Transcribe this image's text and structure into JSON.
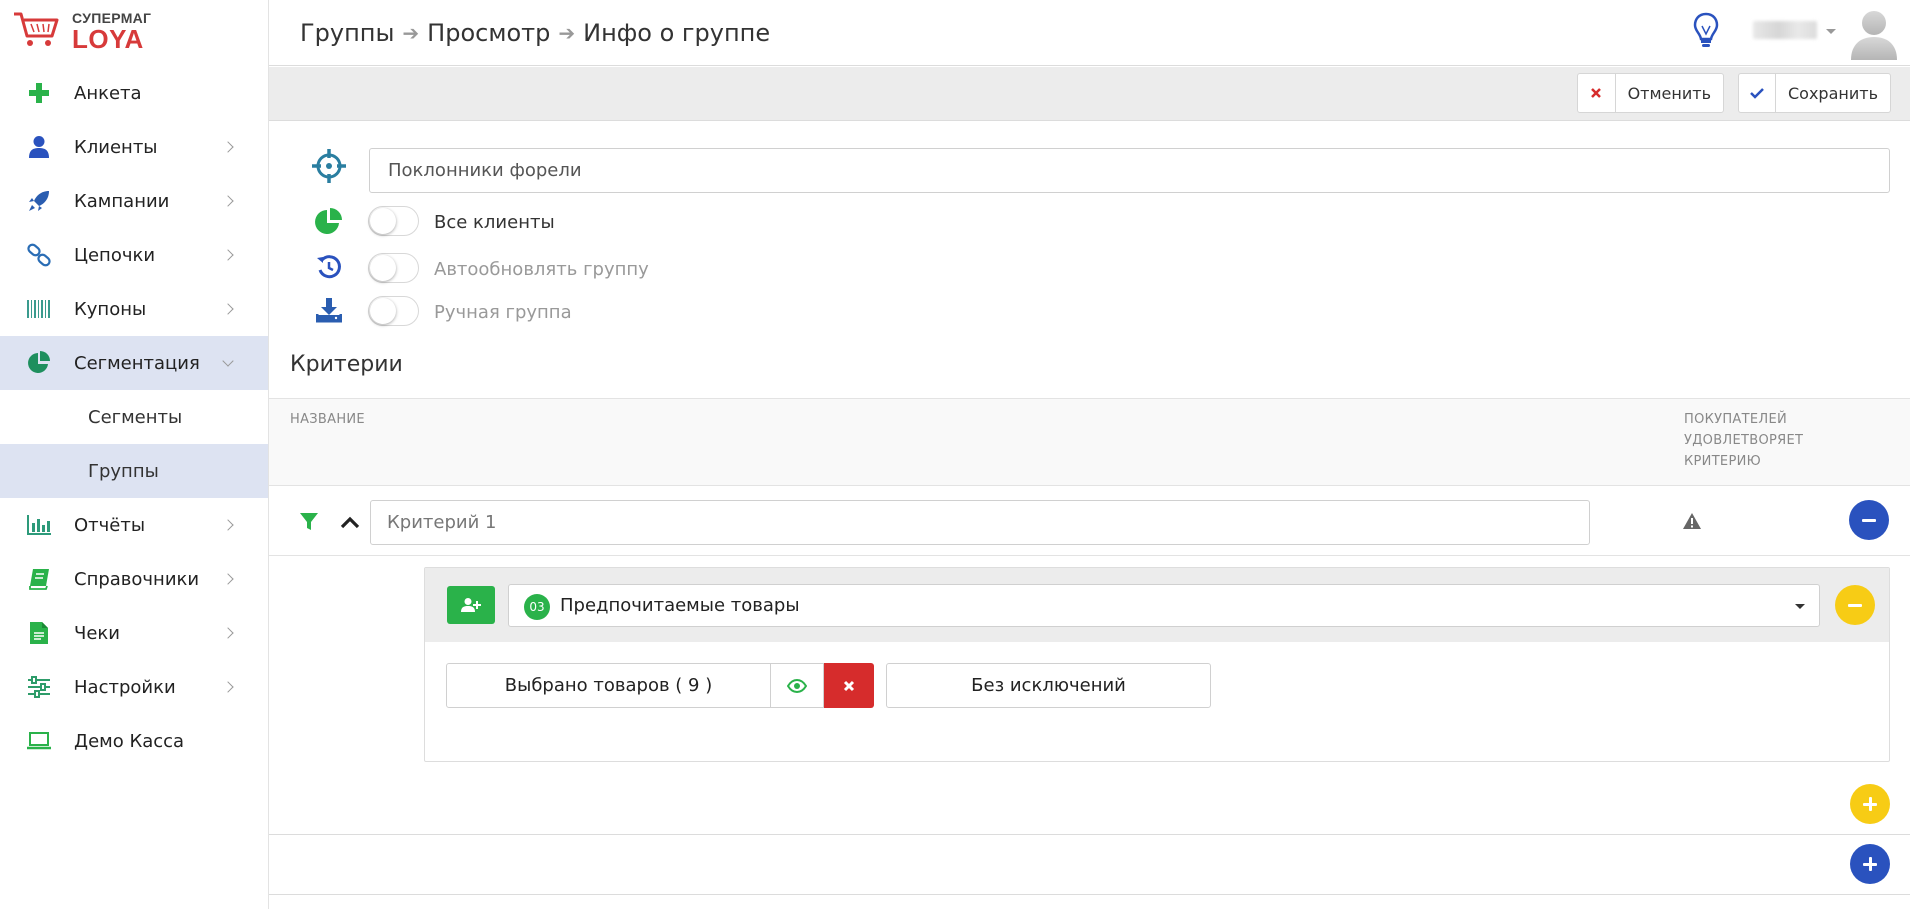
{
  "app": {
    "brand_top": "СУПЕРМАГ",
    "brand_bottom": "LOYA"
  },
  "sidebar": {
    "items": [
      {
        "label": "Анкета",
        "icon": "plus-icon"
      },
      {
        "label": "Клиенты",
        "icon": "user-icon"
      },
      {
        "label": "Кампании",
        "icon": "rocket-icon"
      },
      {
        "label": "Цепочки",
        "icon": "link-icon"
      },
      {
        "label": "Купоны",
        "icon": "barcode-icon"
      },
      {
        "label": "Сегментация",
        "icon": "pie-chart-icon"
      },
      {
        "label": "Отчёты",
        "icon": "bar-chart-icon"
      },
      {
        "label": "Справочники",
        "icon": "book-icon"
      },
      {
        "label": "Чеки",
        "icon": "document-icon"
      },
      {
        "label": "Настройки",
        "icon": "sliders-icon"
      },
      {
        "label": "Демо Касса",
        "icon": "laptop-icon"
      }
    ],
    "subitems": [
      {
        "label": "Сегменты"
      },
      {
        "label": "Группы"
      }
    ]
  },
  "header": {
    "breadcrumb": [
      "Группы",
      "Просмотр",
      "Инфо о группе"
    ]
  },
  "toolbar": {
    "cancel_label": "Отменить",
    "save_label": "Сохранить"
  },
  "form": {
    "group_name": "Поклонники форели",
    "toggles": [
      {
        "label": "Все клиенты",
        "on": false
      },
      {
        "label": "Автообновлять группу",
        "on": false
      },
      {
        "label": "Ручная группа",
        "on": false
      }
    ]
  },
  "criteria": {
    "title": "Критерии",
    "col_name": "НАЗВАНИЕ",
    "col_buyers_lines": [
      "ПОКУПАТЕЛЕЙ",
      "УДОВЛЕТВОРЯЕТ",
      "КРИТЕРИЮ"
    ],
    "criterion_name": "Критерий 1",
    "condition": {
      "number": "03",
      "label": "Предпочитаемые товары",
      "selected_label": "Выбрано товаров ( 9 )",
      "exclusions_label": "Без исключений"
    }
  },
  "colors": {
    "accent_blue": "#2a52be",
    "accent_green": "#2ab24a",
    "accent_yellow": "#f7cc15",
    "danger_red": "#d62c2c",
    "active_bg": "#dde3f2"
  }
}
